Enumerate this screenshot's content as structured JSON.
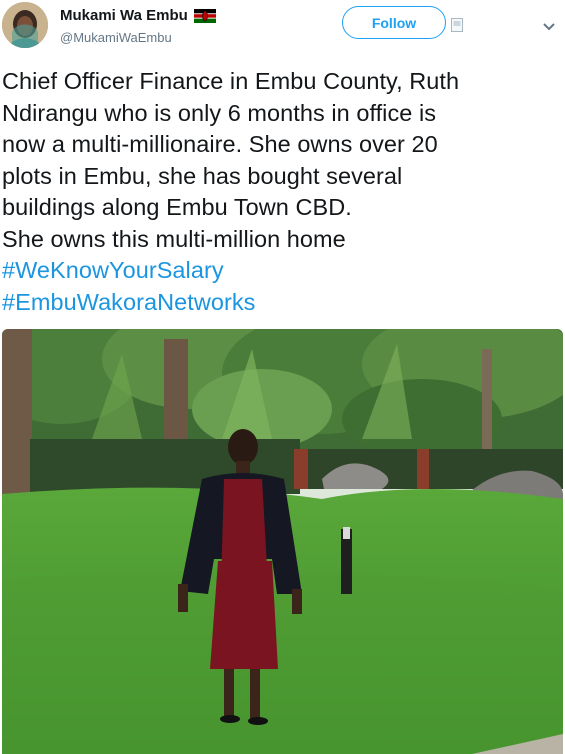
{
  "user": {
    "display_name": "Mukami Wa Embu",
    "handle": "@MukamiWaEmbu"
  },
  "follow_label": "Follow",
  "tweet": {
    "lines": [
      "Chief Officer Finance in Embu County, Ruth",
      "Ndirangu who is only 6 months in office is",
      "now a multi-millionaire. She owns over 20",
      "plots in Embu, she has bought several",
      "buildings along Embu Town CBD.",
      "She owns this multi-million home"
    ],
    "hashtags": [
      "#WeKnowYourSalary",
      "#EmbuWakoraNetworks"
    ]
  },
  "icons": {
    "flag": "kenya-flag-icon",
    "menu": "chevron-down-icon",
    "extra": "image-placeholder-icon"
  },
  "colors": {
    "accent": "#1da1f2",
    "hashtag": "#1b95e0",
    "handle": "#657786"
  }
}
